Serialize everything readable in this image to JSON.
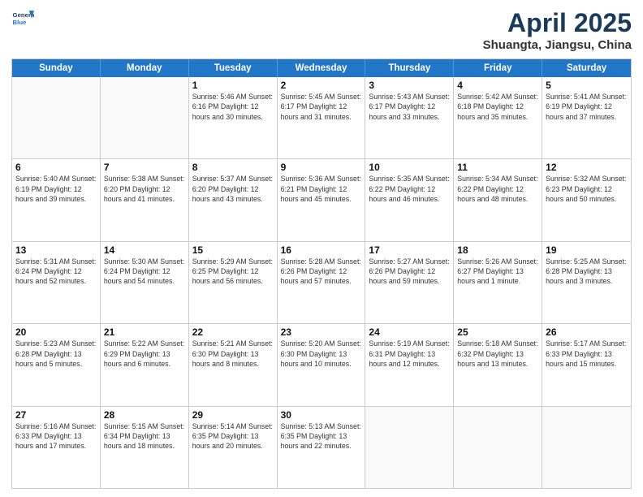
{
  "header": {
    "logo_line1": "General",
    "logo_line2": "Blue",
    "title": "April 2025",
    "location": "Shuangta, Jiangsu, China"
  },
  "days_of_week": [
    "Sunday",
    "Monday",
    "Tuesday",
    "Wednesday",
    "Thursday",
    "Friday",
    "Saturday"
  ],
  "weeks": [
    [
      {
        "day": "",
        "info": ""
      },
      {
        "day": "",
        "info": ""
      },
      {
        "day": "1",
        "info": "Sunrise: 5:46 AM\nSunset: 6:16 PM\nDaylight: 12 hours\nand 30 minutes."
      },
      {
        "day": "2",
        "info": "Sunrise: 5:45 AM\nSunset: 6:17 PM\nDaylight: 12 hours\nand 31 minutes."
      },
      {
        "day": "3",
        "info": "Sunrise: 5:43 AM\nSunset: 6:17 PM\nDaylight: 12 hours\nand 33 minutes."
      },
      {
        "day": "4",
        "info": "Sunrise: 5:42 AM\nSunset: 6:18 PM\nDaylight: 12 hours\nand 35 minutes."
      },
      {
        "day": "5",
        "info": "Sunrise: 5:41 AM\nSunset: 6:19 PM\nDaylight: 12 hours\nand 37 minutes."
      }
    ],
    [
      {
        "day": "6",
        "info": "Sunrise: 5:40 AM\nSunset: 6:19 PM\nDaylight: 12 hours\nand 39 minutes."
      },
      {
        "day": "7",
        "info": "Sunrise: 5:38 AM\nSunset: 6:20 PM\nDaylight: 12 hours\nand 41 minutes."
      },
      {
        "day": "8",
        "info": "Sunrise: 5:37 AM\nSunset: 6:20 PM\nDaylight: 12 hours\nand 43 minutes."
      },
      {
        "day": "9",
        "info": "Sunrise: 5:36 AM\nSunset: 6:21 PM\nDaylight: 12 hours\nand 45 minutes."
      },
      {
        "day": "10",
        "info": "Sunrise: 5:35 AM\nSunset: 6:22 PM\nDaylight: 12 hours\nand 46 minutes."
      },
      {
        "day": "11",
        "info": "Sunrise: 5:34 AM\nSunset: 6:22 PM\nDaylight: 12 hours\nand 48 minutes."
      },
      {
        "day": "12",
        "info": "Sunrise: 5:32 AM\nSunset: 6:23 PM\nDaylight: 12 hours\nand 50 minutes."
      }
    ],
    [
      {
        "day": "13",
        "info": "Sunrise: 5:31 AM\nSunset: 6:24 PM\nDaylight: 12 hours\nand 52 minutes."
      },
      {
        "day": "14",
        "info": "Sunrise: 5:30 AM\nSunset: 6:24 PM\nDaylight: 12 hours\nand 54 minutes."
      },
      {
        "day": "15",
        "info": "Sunrise: 5:29 AM\nSunset: 6:25 PM\nDaylight: 12 hours\nand 56 minutes."
      },
      {
        "day": "16",
        "info": "Sunrise: 5:28 AM\nSunset: 6:26 PM\nDaylight: 12 hours\nand 57 minutes."
      },
      {
        "day": "17",
        "info": "Sunrise: 5:27 AM\nSunset: 6:26 PM\nDaylight: 12 hours\nand 59 minutes."
      },
      {
        "day": "18",
        "info": "Sunrise: 5:26 AM\nSunset: 6:27 PM\nDaylight: 13 hours\nand 1 minute."
      },
      {
        "day": "19",
        "info": "Sunrise: 5:25 AM\nSunset: 6:28 PM\nDaylight: 13 hours\nand 3 minutes."
      }
    ],
    [
      {
        "day": "20",
        "info": "Sunrise: 5:23 AM\nSunset: 6:28 PM\nDaylight: 13 hours\nand 5 minutes."
      },
      {
        "day": "21",
        "info": "Sunrise: 5:22 AM\nSunset: 6:29 PM\nDaylight: 13 hours\nand 6 minutes."
      },
      {
        "day": "22",
        "info": "Sunrise: 5:21 AM\nSunset: 6:30 PM\nDaylight: 13 hours\nand 8 minutes."
      },
      {
        "day": "23",
        "info": "Sunrise: 5:20 AM\nSunset: 6:30 PM\nDaylight: 13 hours\nand 10 minutes."
      },
      {
        "day": "24",
        "info": "Sunrise: 5:19 AM\nSunset: 6:31 PM\nDaylight: 13 hours\nand 12 minutes."
      },
      {
        "day": "25",
        "info": "Sunrise: 5:18 AM\nSunset: 6:32 PM\nDaylight: 13 hours\nand 13 minutes."
      },
      {
        "day": "26",
        "info": "Sunrise: 5:17 AM\nSunset: 6:33 PM\nDaylight: 13 hours\nand 15 minutes."
      }
    ],
    [
      {
        "day": "27",
        "info": "Sunrise: 5:16 AM\nSunset: 6:33 PM\nDaylight: 13 hours\nand 17 minutes."
      },
      {
        "day": "28",
        "info": "Sunrise: 5:15 AM\nSunset: 6:34 PM\nDaylight: 13 hours\nand 18 minutes."
      },
      {
        "day": "29",
        "info": "Sunrise: 5:14 AM\nSunset: 6:35 PM\nDaylight: 13 hours\nand 20 minutes."
      },
      {
        "day": "30",
        "info": "Sunrise: 5:13 AM\nSunset: 6:35 PM\nDaylight: 13 hours\nand 22 minutes."
      },
      {
        "day": "",
        "info": ""
      },
      {
        "day": "",
        "info": ""
      },
      {
        "day": "",
        "info": ""
      }
    ]
  ]
}
